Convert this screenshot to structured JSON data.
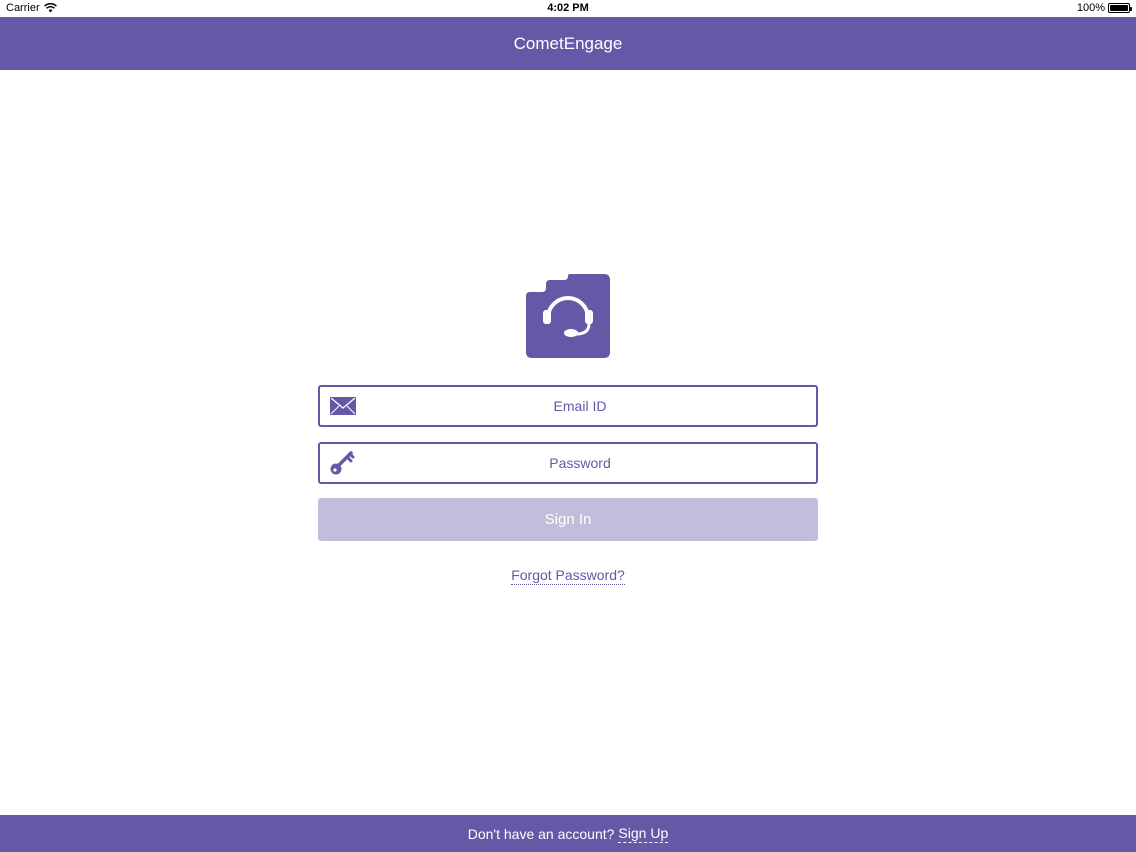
{
  "status_bar": {
    "carrier": "Carrier",
    "time": "4:02 PM",
    "battery": "100%",
    "battery_level": 1.0
  },
  "nav": {
    "title": "CometEngage"
  },
  "logo": {
    "icon": "headset-icon"
  },
  "login_form": {
    "email": {
      "placeholder": "Email ID",
      "value": "",
      "icon": "envelope-icon"
    },
    "password": {
      "placeholder": "Password",
      "value": "",
      "icon": "key-icon"
    },
    "signin_label": "Sign In",
    "forgot_label": "Forgot Password?"
  },
  "footer": {
    "prompt": "Don't have an account?",
    "signup_label": "Sign Up"
  },
  "colors": {
    "brand": "#6657a7",
    "button_disabled": "#c2bddb",
    "background": "#ffffff"
  }
}
